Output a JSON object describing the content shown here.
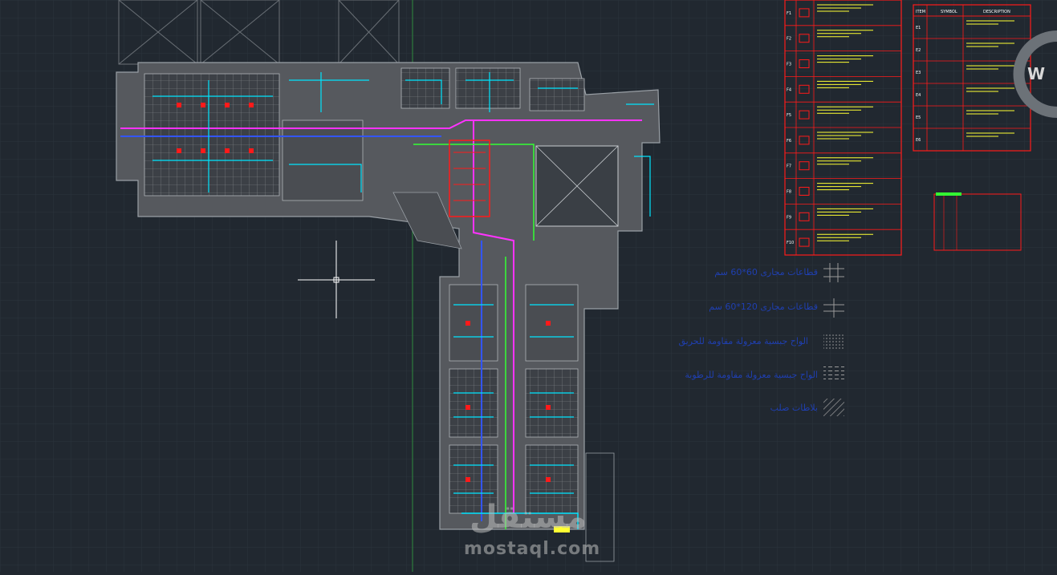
{
  "app": {
    "name": "CAD drawing canvas"
  },
  "legend": {
    "items": [
      {
        "label": "قطاعات مجارى 60*60 سم",
        "symbol": "grid-cross"
      },
      {
        "label": "قطاعات مجارى 120*60 سم",
        "symbol": "grid-cross-double"
      },
      {
        "label": "الواح جبسية معزولة مقاومة للحريق",
        "symbol": "dots"
      },
      {
        "label": "الواح جبسية معزولة مقاومة للرطوبة",
        "symbol": "dashes"
      },
      {
        "label": "بلاطات صلب",
        "symbol": "hatch"
      }
    ]
  },
  "schedule_tables": {
    "left_rows": [
      "F1",
      "F2",
      "F3",
      "F4",
      "F5",
      "F6",
      "F7",
      "F8",
      "F9",
      "F10"
    ],
    "right_header": [
      "ITEM",
      "SYMBOL",
      "DESCRIPTION"
    ],
    "right_rows": [
      "E1",
      "E2",
      "E3",
      "E4",
      "E5",
      "E6"
    ]
  },
  "viewcube": {
    "label": "W"
  },
  "watermark": {
    "arabic": "مستقل",
    "latin": "mostaql.com"
  },
  "colors": {
    "background": "#212830",
    "grid": "#2c343d",
    "wall": "#5a5e63",
    "cyan": "#00e5ff",
    "red": "#ff1a1a",
    "green": "#33ff33",
    "magenta": "#ff33ff",
    "blue": "#3355ff",
    "yellow": "#ffff33"
  }
}
